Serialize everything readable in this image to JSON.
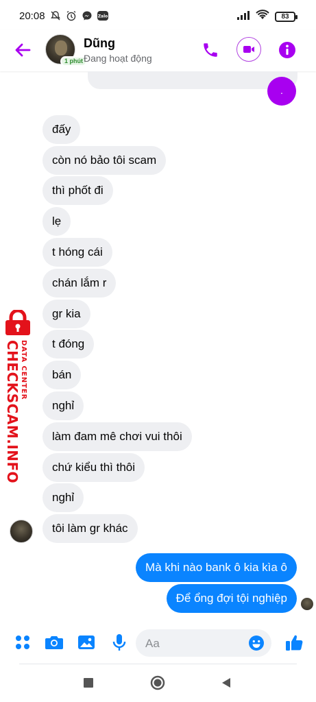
{
  "status_bar": {
    "time": "20:08",
    "battery": "83",
    "icons_left": [
      "mute-icon",
      "alarm-icon",
      "messenger-icon",
      "zalo-icon"
    ],
    "icons_right": [
      "signal-icon",
      "wifi-icon",
      "battery-icon"
    ]
  },
  "header": {
    "contact_name": "Dũng",
    "status": "Đang hoạt động",
    "active_badge": "1 phút",
    "accent_color": "#a800f0"
  },
  "chat": {
    "incoming": [
      "đấy",
      "còn nó bảo tôi scam",
      "thì phốt đi",
      "lẹ",
      "t hóng cái",
      "chán lắm r",
      "gr kia",
      "t đóng",
      "bán",
      "nghỉ",
      "làm đam mê chơi vui thôi",
      "chứ kiểu thì thôi",
      "nghỉ",
      "tôi làm gr khác"
    ],
    "outgoing": [
      "Mà khi nào bank ô kia kìa ô",
      "Để ổng đợi tội nghiệp"
    ],
    "purple_dot_text": ".",
    "incoming_bubble_color": "#eeeff2",
    "outgoing_bubble_color": "#0a84ff"
  },
  "watermark": {
    "main": "CHECKSCAM.INFO",
    "sub": "DATA CENTER",
    "color": "#e3121b"
  },
  "composer": {
    "placeholder": "Aa",
    "buttons": [
      "menu-icon",
      "camera-icon",
      "gallery-icon",
      "mic-icon",
      "emoji-icon",
      "like-icon"
    ]
  },
  "nav": {
    "buttons": [
      "recents-button",
      "home-button",
      "back-button"
    ]
  }
}
